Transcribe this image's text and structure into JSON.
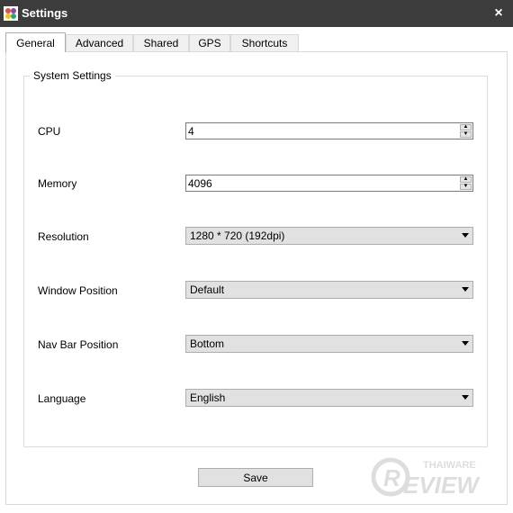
{
  "window": {
    "title": "Settings",
    "close_symbol": "×"
  },
  "tabs": [
    {
      "label": "General",
      "active": true
    },
    {
      "label": "Advanced",
      "active": false
    },
    {
      "label": "Shared",
      "active": false
    },
    {
      "label": "GPS",
      "active": false
    },
    {
      "label": "Shortcuts",
      "active": false
    }
  ],
  "system_settings": {
    "group_title": "System Settings",
    "cpu": {
      "label": "CPU",
      "value": "4"
    },
    "memory": {
      "label": "Memory",
      "value": "4096"
    },
    "resolution": {
      "label": "Resolution",
      "value": "1280 * 720 (192dpi)"
    },
    "window_position": {
      "label": "Window Position",
      "value": "Default"
    },
    "nav_bar_position": {
      "label": "Nav Bar Position",
      "value": "Bottom"
    },
    "language": {
      "label": "Language",
      "value": "English"
    }
  },
  "save_label": "Save",
  "watermark": {
    "brand_top": "THAIWARE",
    "brand_main": "REVIEW"
  },
  "icons": {
    "app": "app-logo-icon",
    "close": "close-icon",
    "spin": "spin-arrows-icon",
    "dropdown": "chevron-down-icon"
  }
}
